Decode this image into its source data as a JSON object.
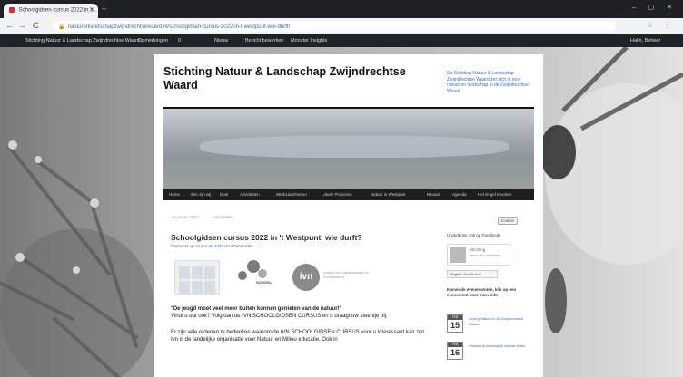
{
  "browser": {
    "tab_title": "Schoolgidsen cursus 2022 in 't...",
    "new_tab": "+",
    "window_controls": "– ▢ ✕",
    "url": "natuurenlandschapzwijndrechtsewaard.nl/schoolgidsen-cursus-2022-in-t-westpunt-wie-durft/",
    "nav_back": "←",
    "nav_forward": "→",
    "nav_reload": "C",
    "addr_icons": "☆ ⋮"
  },
  "adminbar": {
    "items": [
      "Stichting Natuur & Landschap Zwijndrechtse Waard",
      "Opmerkingen",
      "0",
      "Nieuw",
      "Bericht bewerken",
      "Monster Insights"
    ],
    "user": "Hallo, Beheer"
  },
  "site": {
    "title": "Stichting Natuur & Landschap Zwijndrechtse Waard",
    "description": "De Stichting Natuur & Landschap Zwijndrechtse Waard zet zich in voor natuur en landschap in de Zwijndrechtse Waard."
  },
  "menu": [
    "Home",
    "Wie zijn wij",
    "Doel",
    "Activiteiten",
    "Werkzaamheden",
    "Lokale Projecten",
    "Natuur in Westpunt",
    "Nieuws",
    "Agenda",
    "Het Engel Klooster"
  ],
  "post": {
    "date_tag": "19 januari 2022",
    "category": "Activiteiten",
    "title": "Schoolgidsen cursus 2022 in 't Westpunt, wie durft?",
    "meta_prefix": "Geplaatst op",
    "meta_date": "19 januari 2022",
    "meta_author": "door beheerder",
    "logo_text_1": "SCHOOL",
    "logo_text_2": "Instituut voor Natuureducatie en Duurzaamheid",
    "logo_ivn": "ivn",
    "para1_bold": "\"De jeugd moet veel meer buiten kunnen genieten van de natuur!\"",
    "para1_rest": "Vindt u dat ook? Volg dan de IVN SCHOOLGIDSEN CURSUS en u draagt uw steentje bij.",
    "para2": "Er zijn vele redenen te bedenken waarom de IVN SCHOOLGIDSEN CURSUS voor u interessant kan zijn. Ivn is de landelijke organisatie voor Natuur en Milieu educatie. Ook in"
  },
  "sidebar": {
    "search_label": "Zoeken",
    "fb_heading": "U vindt ons ook op Facebook:",
    "fb_name": "Stichting",
    "fb_sub": "Natuur en Landschap",
    "like_label": "Pagina Vind ik leuk",
    "events_heading": "Komende evenementen, klik op een evenement voor meer info",
    "events": [
      {
        "month": "FEB",
        "day": "15",
        "title": "Lezing Natuur in de Zwijndrechtse Waard"
      },
      {
        "month": "FEB",
        "day": "16",
        "title": "Workshop natuurgids nieuwe leden"
      }
    ]
  },
  "colors": {
    "link": "#3d6ec4",
    "admin_bg": "#1d2327",
    "menu_bg": "#1e1e1e"
  }
}
